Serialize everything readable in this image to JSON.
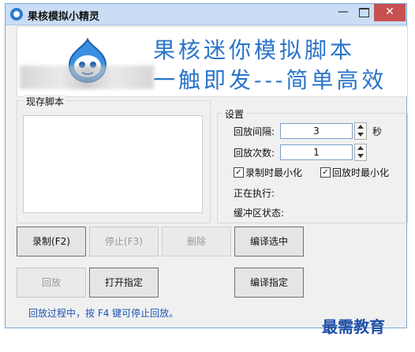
{
  "window": {
    "title": "果核模拟小精灵",
    "min_label": "—",
    "close_label": "✕"
  },
  "banner": {
    "line1": "果核迷你模拟脚本",
    "line2": "一触即发---简单高效"
  },
  "script_panel": {
    "label": "现存脚本"
  },
  "settings": {
    "label": "设置",
    "interval_label": "回放间隔:",
    "interval_value": "3",
    "interval_unit": "秒",
    "count_label": "回放次数:",
    "count_value": "1",
    "min_on_record": {
      "label": "录制时最小化",
      "checked": true
    },
    "min_on_play": {
      "label": "回放时最小化",
      "checked": true
    },
    "executing_label": "正在执行:",
    "buffer_label": "缓冲区状态:"
  },
  "buttons": {
    "record": "录制(F2)",
    "stop": "停止(F3)",
    "delete": "删除",
    "compile_selected": "编译选中",
    "play": "回放",
    "open_specified": "打开指定",
    "compile_specified": "编译指定"
  },
  "status_text": "回放过程中，按 F4 键可停止回放。",
  "watermark": "最需教育"
}
